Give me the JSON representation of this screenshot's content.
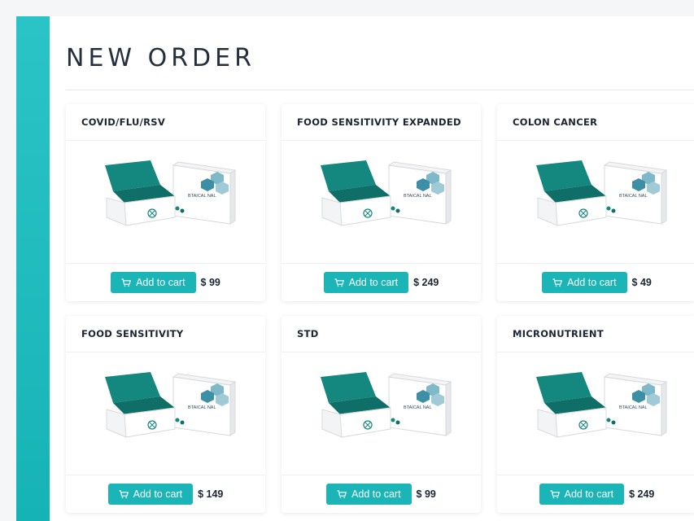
{
  "page": {
    "title": "NEW ORDER"
  },
  "colors": {
    "accent": "#1bb5b8",
    "teal_box": "#14877f"
  },
  "products": [
    {
      "name": "COVID/FLU/RSV",
      "button_label": "Add to cart",
      "price": "$ 99",
      "icon": "cart-icon",
      "box_brand": "BTAICAL NAL"
    },
    {
      "name": "FOOD SENSITIVITY EXPANDED",
      "button_label": "Add to cart",
      "price": "$ 249",
      "icon": "cart-icon",
      "box_brand": "BTAICAL NAL"
    },
    {
      "name": "COLON CANCER",
      "button_label": "Add to cart",
      "price": "$ 49",
      "icon": "cart-icon",
      "box_brand": "BTAICAL NAL"
    },
    {
      "name": "FOOD SENSITIVITY",
      "button_label": "Add to cart",
      "price": "$ 149",
      "icon": "cart-icon",
      "box_brand": "BTAICAL NAL"
    },
    {
      "name": "STD",
      "button_label": "Add to cart",
      "price": "$ 99",
      "icon": "cart-icon",
      "box_brand": "BTAICAL NAL"
    },
    {
      "name": "MICRONUTRIENT",
      "button_label": "Add to cart",
      "price": "$ 249",
      "icon": "cart-icon",
      "box_brand": "BTAICAL NAL"
    }
  ]
}
